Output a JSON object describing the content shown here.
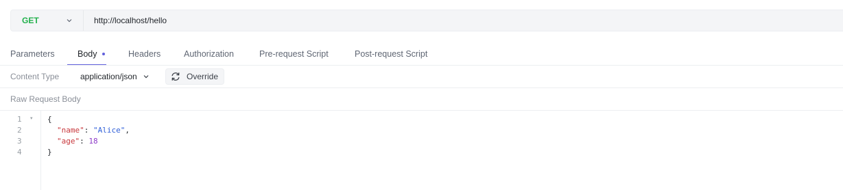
{
  "request": {
    "method": "GET",
    "url": "http://localhost/hello"
  },
  "tabs": [
    {
      "label": "Parameters",
      "active": false
    },
    {
      "label": "Body",
      "active": true
    },
    {
      "label": "Headers",
      "active": false
    },
    {
      "label": "Authorization",
      "active": false
    },
    {
      "label": "Pre-request Script",
      "active": false
    },
    {
      "label": "Post-request Script",
      "active": false
    }
  ],
  "body": {
    "content_type_label": "Content Type",
    "content_type_value": "application/json",
    "override_label": "Override",
    "raw_label": "Raw Request Body",
    "line_numbers": [
      "1",
      "2",
      "3",
      "4"
    ],
    "code": {
      "open_brace": "{",
      "name_key": "\"name\"",
      "name_value": "\"Alice\"",
      "age_key": "\"age\"",
      "age_value": "18",
      "close_brace": "}"
    }
  },
  "colors": {
    "method_get": "#23b14d",
    "accent": "#6160dc",
    "json_key": "#c8383d",
    "json_string": "#2f5fd8",
    "json_number": "#8c3ac8"
  },
  "icons": {
    "method_dropdown": "chevron-down-icon",
    "content_type_dropdown": "chevron-down-icon",
    "override": "refresh-icon",
    "fold": "fold-caret-icon"
  }
}
